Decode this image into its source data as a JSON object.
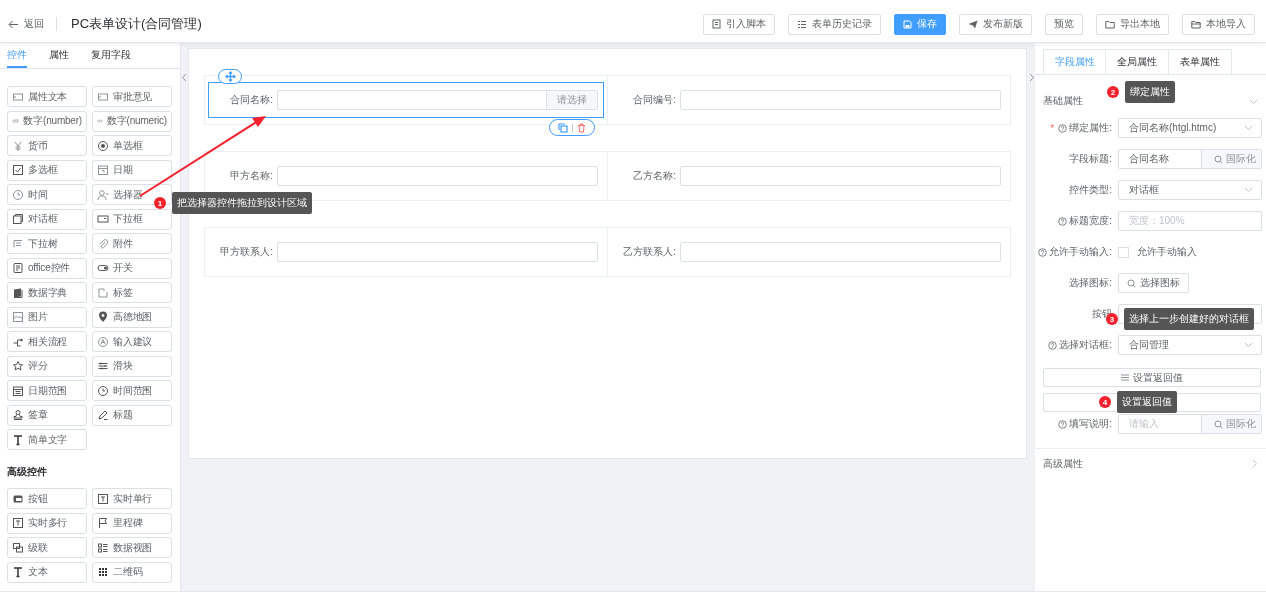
{
  "header": {
    "back": "返回",
    "title": "PC表单设计(合同管理)",
    "buttons": [
      {
        "label": "引入脚本",
        "primary": false
      },
      {
        "label": "表单历史记录",
        "primary": false
      },
      {
        "label": "保存",
        "primary": true
      },
      {
        "label": "发布新版",
        "primary": false
      },
      {
        "label": "预览",
        "primary": false
      },
      {
        "label": "导出本地",
        "primary": false
      },
      {
        "label": "本地导入",
        "primary": false
      }
    ]
  },
  "left_tabs": [
    {
      "label": "控件",
      "selected": true
    },
    {
      "label": "属性",
      "selected": false
    },
    {
      "label": "复用字段",
      "selected": false
    }
  ],
  "widget_groups": [
    {
      "items": [
        "属性文本",
        "审批意见",
        "数字(number)",
        "数字(numeric)",
        "货币",
        "单选框",
        "多选框",
        "日期",
        "时间",
        "选择器",
        "对话框",
        "下拉框",
        "下拉树",
        "附件",
        "office控件",
        "开关",
        "数据字典",
        "标签",
        "图片",
        "高德地图",
        "相关流程",
        "输入建议",
        "评分",
        "滑块",
        "日期范围",
        "时间范围",
        "签章",
        "标题",
        "简单文字"
      ]
    },
    {
      "title": "高级控件",
      "items": [
        "按钮",
        "实时单行",
        "实时多行",
        "里程碑",
        "级联",
        "数据视图",
        "文本",
        "二维码"
      ]
    }
  ],
  "form_rows": [
    {
      "cells": [
        {
          "label": "合同名称:",
          "selected": true,
          "addon": "请选择"
        },
        {
          "label": "合同编号:",
          "selected": false
        }
      ]
    },
    {
      "cells": [
        {
          "label": "甲方名称:",
          "selected": false
        },
        {
          "label": "乙方名称:",
          "selected": false
        }
      ]
    },
    {
      "cells": [
        {
          "label": "甲方联系人:",
          "selected": false
        },
        {
          "label": "乙方联系人:",
          "selected": false
        }
      ]
    }
  ],
  "right_tabs": [
    {
      "label": "字段属性",
      "selected": true
    },
    {
      "label": "全局属性",
      "selected": false
    },
    {
      "label": "表单属性",
      "selected": false
    }
  ],
  "basic_section": {
    "title": "基础属性",
    "expanded": true
  },
  "fields": [
    {
      "kind": "select",
      "required_mark": "*",
      "help": true,
      "label": "绑定属性:",
      "value": "合同名称(htgl.htmc)"
    },
    {
      "kind": "input_addon",
      "help": false,
      "label": "字段标题:",
      "value": "合同名称",
      "addon": "国际化"
    },
    {
      "kind": "select",
      "help": false,
      "label": "控件类型:",
      "value": "对话框"
    },
    {
      "kind": "input",
      "help": true,
      "label": "标题宽度:",
      "placeholder": "宽度：100%"
    },
    {
      "kind": "checkbox",
      "help": true,
      "label": "允许手动输入:",
      "checked": false,
      "text": "允许手动输入"
    },
    {
      "kind": "button",
      "help": false,
      "label": "选择图标:",
      "button": "选择图标"
    },
    {
      "kind": "input",
      "help": false,
      "label": "按钮"
    },
    {
      "kind": "select",
      "help": true,
      "label": "选择对话框:",
      "value": "合同管理"
    }
  ],
  "wide_buttons": [
    {
      "kind": "labeled",
      "label": "设置返回值"
    },
    {
      "kind": "covered"
    }
  ],
  "note_field": {
    "kind": "input_addon",
    "help": true,
    "label": "填写说明:",
    "placeholder": "请输入",
    "addon": "国际化"
  },
  "advanced_section": {
    "title": "高级属性",
    "expanded": false
  },
  "annotations": [
    {
      "number": "1",
      "text": "把选择器控件拖拉到设计区域"
    },
    {
      "number": "2",
      "text": "绑定属性"
    },
    {
      "number": "3",
      "text": "选择上一步创建好的对话框"
    },
    {
      "number": "4",
      "text": "设置返回值"
    }
  ]
}
